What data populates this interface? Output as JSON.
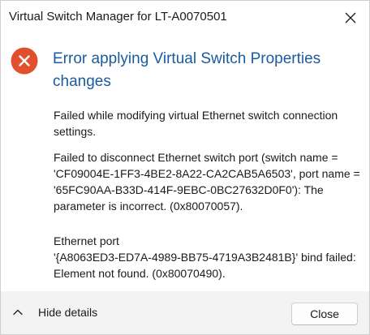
{
  "window": {
    "title": "Virtual Switch Manager for LT-A0070501"
  },
  "dialog": {
    "icon": "error-icon",
    "heading_line1": "Error applying Virtual Switch Properties",
    "heading_line2": "changes",
    "paragraph1": [
      "Failed while modifying virtual Ethernet switch connection",
      "settings."
    ],
    "paragraph2": [
      "Failed to disconnect Ethernet switch port (switch name =",
      "'CF09004E-1FF3-4BE2-8A22-CA2CAB5A6503', port name =",
      "'65FC90AA-B33D-414F-9EBC-0BC27632D0F0'): The",
      "parameter is incorrect. (0x80070057)."
    ],
    "paragraph3": [
      "Ethernet port",
      "'{A8063ED3-ED7A-4989-BB75-4719A3B2481B}' bind failed:",
      "Element not found. (0x80070490)."
    ]
  },
  "footer": {
    "hide_details_label": "Hide details",
    "close_label": "Close"
  },
  "colors": {
    "heading": "#1a5b9e",
    "error_icon": "#e0502c",
    "footer_bg": "#f3f3f3"
  }
}
